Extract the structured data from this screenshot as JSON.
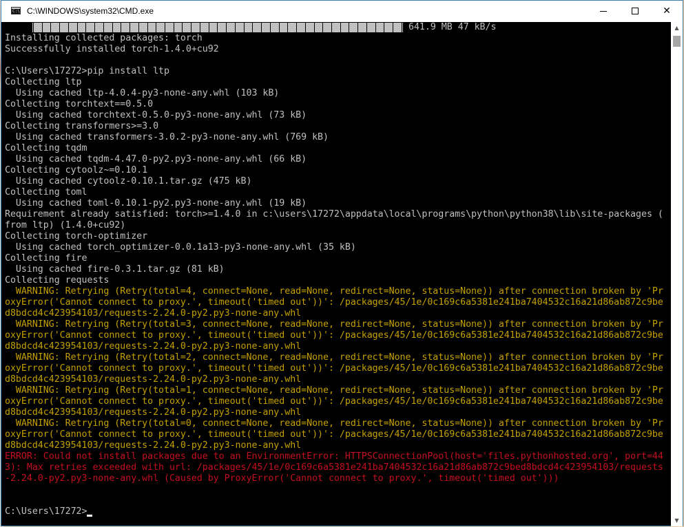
{
  "window": {
    "title": "C:\\WINDOWS\\system32\\CMD.exe",
    "app_icon_label": "C:\\",
    "minimize_glyph": "",
    "maximize_glyph": "",
    "close_glyph": "✕"
  },
  "scrollbar": {
    "up_glyph": "▲",
    "down_glyph": "▼",
    "position_fraction": 0.0
  },
  "progress": {
    "fraction": 1.0,
    "text": "641.9 MB 47 kB/s"
  },
  "colors": {
    "output": "#c0c0c0",
    "warning": "#c4a000",
    "error": "#c50f1f",
    "background": "#000000"
  },
  "console": {
    "lines": [
      {
        "text": "Installing collected packages: torch",
        "style": "normal"
      },
      {
        "text": "Successfully installed torch-1.4.0+cu92",
        "style": "normal"
      },
      {
        "text": "",
        "style": "normal"
      },
      {
        "text": "C:\\Users\\17272>pip install ltp",
        "style": "normal"
      },
      {
        "text": "Collecting ltp",
        "style": "normal"
      },
      {
        "text": "  Using cached ltp-4.0.4-py3-none-any.whl (103 kB)",
        "style": "normal"
      },
      {
        "text": "Collecting torchtext==0.5.0",
        "style": "normal"
      },
      {
        "text": "  Using cached torchtext-0.5.0-py3-none-any.whl (73 kB)",
        "style": "normal"
      },
      {
        "text": "Collecting transformers>=3.0",
        "style": "normal"
      },
      {
        "text": "  Using cached transformers-3.0.2-py3-none-any.whl (769 kB)",
        "style": "normal"
      },
      {
        "text": "Collecting tqdm",
        "style": "normal"
      },
      {
        "text": "  Using cached tqdm-4.47.0-py2.py3-none-any.whl (66 kB)",
        "style": "normal"
      },
      {
        "text": "Collecting cytoolz~=0.10.1",
        "style": "normal"
      },
      {
        "text": "  Using cached cytoolz-0.10.1.tar.gz (475 kB)",
        "style": "normal"
      },
      {
        "text": "Collecting toml",
        "style": "normal"
      },
      {
        "text": "  Using cached toml-0.10.1-py2.py3-none-any.whl (19 kB)",
        "style": "normal"
      },
      {
        "text": "Requirement already satisfied: torch>=1.4.0 in c:\\users\\17272\\appdata\\local\\programs\\python\\python38\\lib\\site-packages (",
        "style": "normal"
      },
      {
        "text": "from ltp) (1.4.0+cu92)",
        "style": "normal"
      },
      {
        "text": "Collecting torch-optimizer",
        "style": "normal"
      },
      {
        "text": "  Using cached torch_optimizer-0.0.1a13-py3-none-any.whl (35 kB)",
        "style": "normal"
      },
      {
        "text": "Collecting fire",
        "style": "normal"
      },
      {
        "text": "  Using cached fire-0.3.1.tar.gz (81 kB)",
        "style": "normal"
      },
      {
        "text": "Collecting requests",
        "style": "normal"
      },
      {
        "text": "  WARNING: Retrying (Retry(total=4, connect=None, read=None, redirect=None, status=None)) after connection broken by 'Pr",
        "style": "warning"
      },
      {
        "text": "oxyError('Cannot connect to proxy.', timeout('timed out'))': /packages/45/1e/0c169c6a5381e241ba7404532c16a21d86ab872c9be",
        "style": "warning"
      },
      {
        "text": "d8bdcd4c423954103/requests-2.24.0-py2.py3-none-any.whl",
        "style": "warning"
      },
      {
        "text": "  WARNING: Retrying (Retry(total=3, connect=None, read=None, redirect=None, status=None)) after connection broken by 'Pr",
        "style": "warning"
      },
      {
        "text": "oxyError('Cannot connect to proxy.', timeout('timed out'))': /packages/45/1e/0c169c6a5381e241ba7404532c16a21d86ab872c9be",
        "style": "warning"
      },
      {
        "text": "d8bdcd4c423954103/requests-2.24.0-py2.py3-none-any.whl",
        "style": "warning"
      },
      {
        "text": "  WARNING: Retrying (Retry(total=2, connect=None, read=None, redirect=None, status=None)) after connection broken by 'Pr",
        "style": "warning"
      },
      {
        "text": "oxyError('Cannot connect to proxy.', timeout('timed out'))': /packages/45/1e/0c169c6a5381e241ba7404532c16a21d86ab872c9be",
        "style": "warning"
      },
      {
        "text": "d8bdcd4c423954103/requests-2.24.0-py2.py3-none-any.whl",
        "style": "warning"
      },
      {
        "text": "  WARNING: Retrying (Retry(total=1, connect=None, read=None, redirect=None, status=None)) after connection broken by 'Pr",
        "style": "warning"
      },
      {
        "text": "oxyError('Cannot connect to proxy.', timeout('timed out'))': /packages/45/1e/0c169c6a5381e241ba7404532c16a21d86ab872c9be",
        "style": "warning"
      },
      {
        "text": "d8bdcd4c423954103/requests-2.24.0-py2.py3-none-any.whl",
        "style": "warning"
      },
      {
        "text": "  WARNING: Retrying (Retry(total=0, connect=None, read=None, redirect=None, status=None)) after connection broken by 'Pr",
        "style": "warning"
      },
      {
        "text": "oxyError('Cannot connect to proxy.', timeout('timed out'))': /packages/45/1e/0c169c6a5381e241ba7404532c16a21d86ab872c9be",
        "style": "warning"
      },
      {
        "text": "d8bdcd4c423954103/requests-2.24.0-py2.py3-none-any.whl",
        "style": "warning"
      },
      {
        "text": "ERROR: Could not install packages due to an EnvironmentError: HTTPSConnectionPool(host='files.pythonhosted.org', port=44",
        "style": "error"
      },
      {
        "text": "3): Max retries exceeded with url: /packages/45/1e/0c169c6a5381e241ba7404532c16a21d86ab872c9bed8bdcd4c423954103/requests",
        "style": "error"
      },
      {
        "text": "-2.24.0-py2.py3-none-any.whl (Caused by ProxyError('Cannot connect to proxy.', timeout('timed out')))",
        "style": "error"
      },
      {
        "text": "",
        "style": "normal"
      },
      {
        "text": "",
        "style": "normal"
      }
    ],
    "prompt": "C:\\Users\\17272>"
  }
}
